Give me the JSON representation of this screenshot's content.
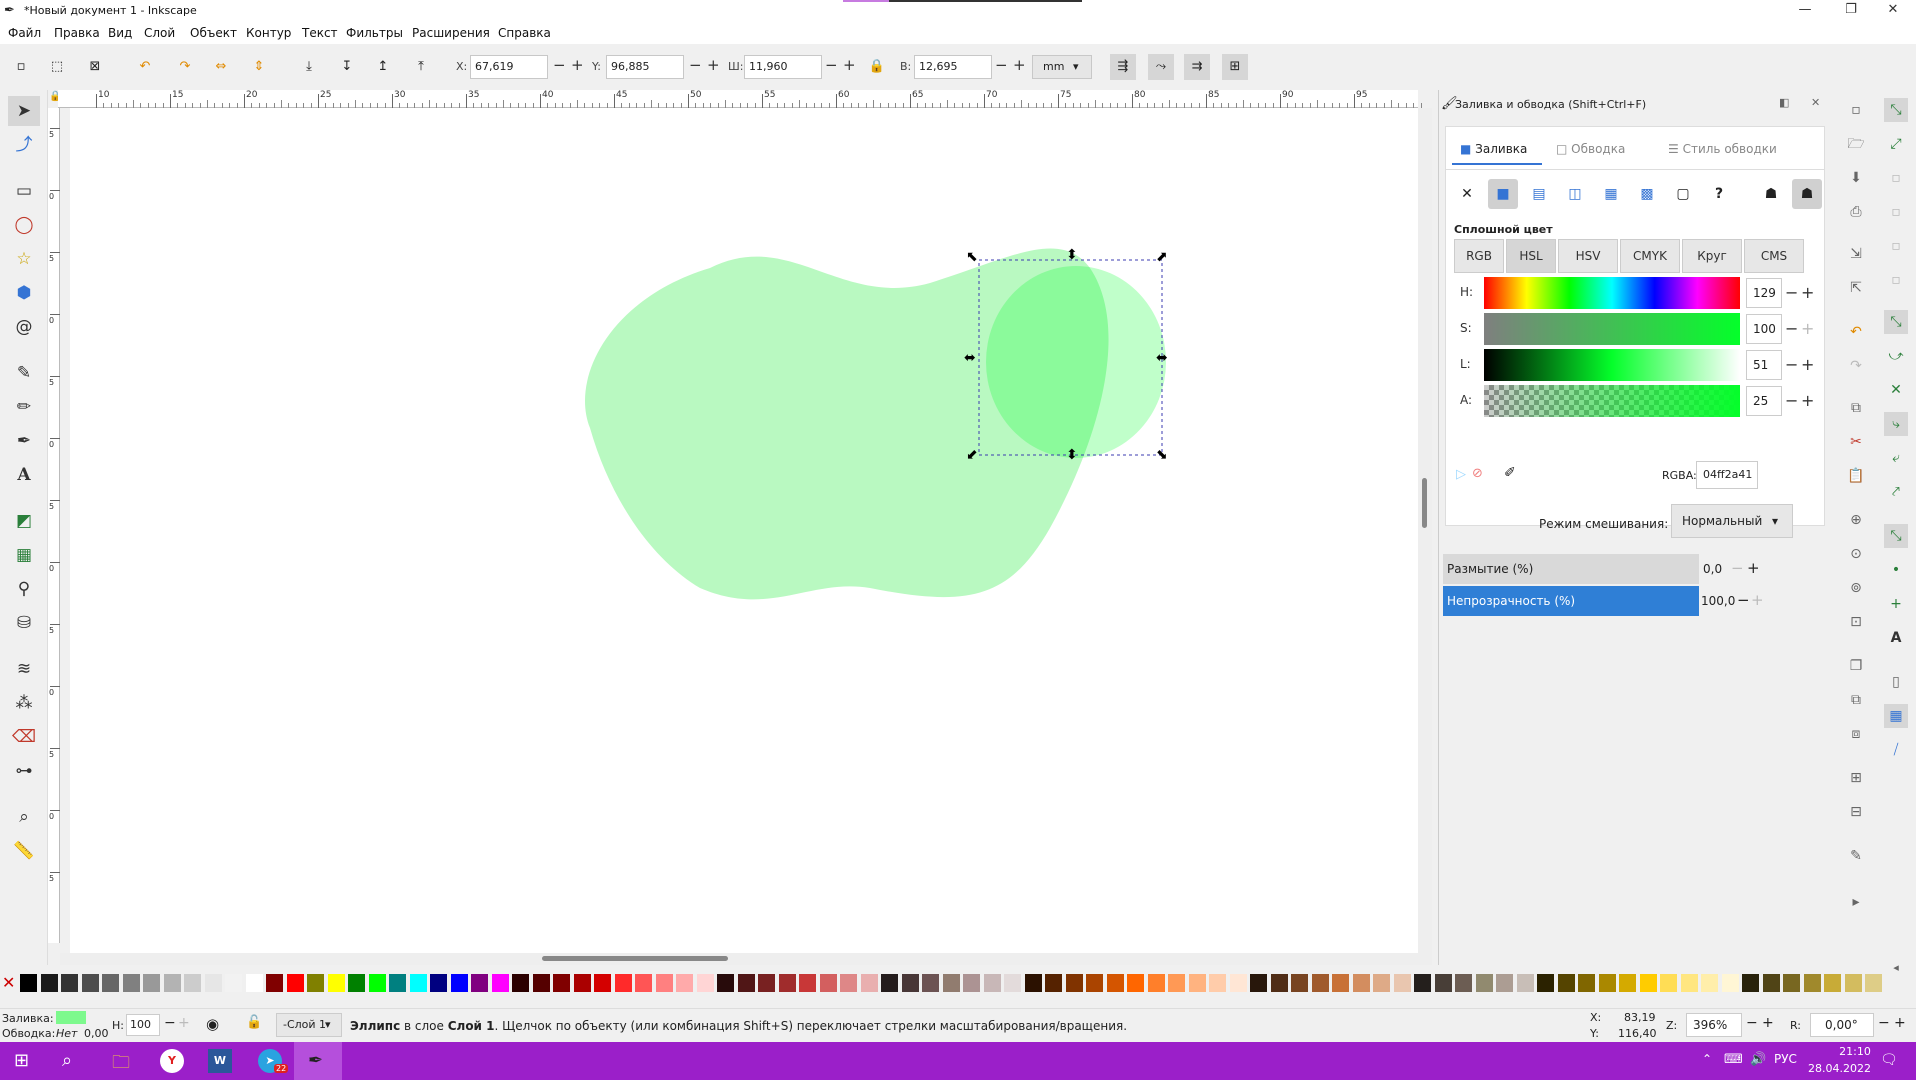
{
  "window": {
    "title": "*Новый документ 1 - Inkscape",
    "min": "—",
    "max": "❐",
    "close": "✕"
  },
  "menu": [
    "Файл",
    "Правка",
    "Вид",
    "Слой",
    "Объект",
    "Контур",
    "Текст",
    "Фильтры",
    "Расширения",
    "Справка"
  ],
  "toolctl": {
    "x_label": "X:",
    "x_value": "67,619",
    "y_label": "Y:",
    "y_value": "96,885",
    "w_label": "Ш:",
    "w_value": "11,960",
    "h_label": "В:",
    "h_value": "12,695",
    "unit": "mm"
  },
  "ruler_top": [
    "10",
    "15",
    "20",
    "25",
    "30",
    "35",
    "40",
    "45",
    "50",
    "55",
    "60",
    "65",
    "70",
    "75",
    "80",
    "85",
    "90",
    "95"
  ],
  "ruler_left": [
    "5",
    "0",
    "5",
    "0",
    "5",
    "0",
    "5",
    "0",
    "5",
    "0",
    "5",
    "0",
    "5"
  ],
  "dock": {
    "title": "Заливка и обводка (Shift+Ctrl+F)",
    "tabs": [
      "Заливка",
      "Обводка",
      "Стиль обводки"
    ],
    "paint_types": [
      "✕",
      "■",
      "▤",
      "◫",
      "▦",
      "▩",
      "▢",
      "?",
      "☗",
      "☗"
    ],
    "solid_label": "Сплошной цвет",
    "modes": [
      "RGB",
      "HSL",
      "HSV",
      "CMYK",
      "Круг",
      "CMS"
    ],
    "sliders": [
      {
        "label": "H:",
        "value": "129"
      },
      {
        "label": "S:",
        "value": "100"
      },
      {
        "label": "L:",
        "value": "51"
      },
      {
        "label": "A:",
        "value": "25"
      }
    ],
    "rgba_label": "RGBA:",
    "rgba_value": "04ff2a41",
    "blend_label": "Режим смешивания:",
    "blend_value": "Нормальный",
    "blur_label": "Размытие (%)",
    "blur_value": "0,0",
    "opacity_label": "Непрозрачность (%)",
    "opacity_value": "100,0"
  },
  "status": {
    "fill_label": "Заливка:",
    "stroke_label": "Обводка:",
    "stroke_value": "Нет",
    "stroke_width": "0,00",
    "h_label": "Н:",
    "h_value": "100",
    "layer": "-Слой 1",
    "msg_obj": "Эллипс",
    "msg_mid": " в слое ",
    "msg_layer": "Слой 1",
    "msg_rest": ". Щелчок по объекту (или комбинация Shift+S) переключает стрелки масштабирования/вращения.",
    "x_label": "X:",
    "x_value": "83,19",
    "y_label": "Y:",
    "y_value": "116,40",
    "z_label": "Z:",
    "zoom": "396%",
    "r_label": "R:",
    "rotation": "0,00°"
  },
  "taskbar": {
    "lang": "РУС",
    "time": "21:10",
    "date": "28.04.2022",
    "badge": "22"
  },
  "colors": {
    "shape1": "#b9f9c1",
    "ellipse": "#04ff2a",
    "accent": "#3574d4",
    "taskbar": "#9b1fc9"
  }
}
